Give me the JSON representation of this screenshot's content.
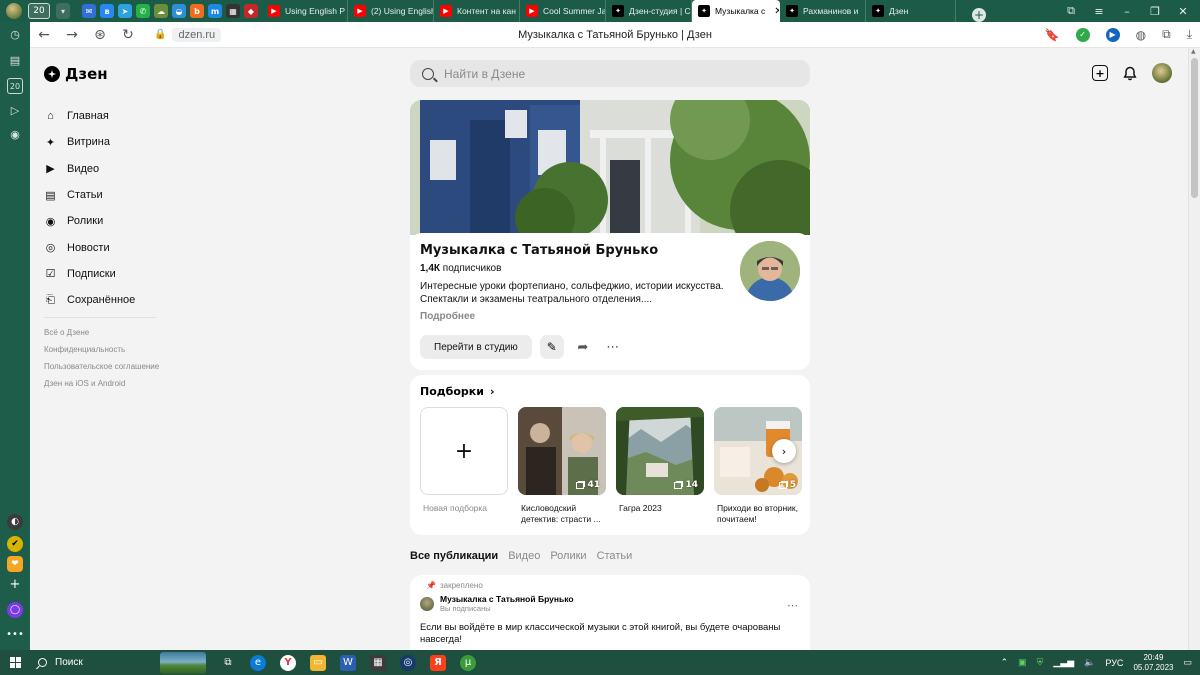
{
  "browser": {
    "tab_count": "20",
    "tabs": [
      {
        "label": "Using English P",
        "icon": "youtube-icon",
        "color": "#ff0000"
      },
      {
        "label": "(2) Using English",
        "icon": "youtube-icon",
        "color": "#ff0000"
      },
      {
        "label": "Контент на кан",
        "icon": "youtube-icon",
        "color": "#ff0000"
      },
      {
        "label": "Cool Summer Ja",
        "icon": "youtube-icon",
        "color": "#ff0000"
      },
      {
        "label": "Дзен-студия | С",
        "icon": "dzen-icon",
        "color": "#000000"
      },
      {
        "label": "Музыкалка с",
        "icon": "dzen-icon",
        "color": "#000000",
        "active": true
      },
      {
        "label": "Рахманинов и",
        "icon": "dzen-icon",
        "color": "#000000"
      },
      {
        "label": "Дзен",
        "icon": "dzen-icon",
        "color": "#000000"
      }
    ],
    "url_domain": "dzen.ru",
    "page_title": "Музыкалка с Татьяной Брунько | Дзен",
    "side_badge": "20"
  },
  "dzen": {
    "logo": "Дзен",
    "search_placeholder": "Найти в Дзене",
    "menu": [
      {
        "label": "Главная",
        "icon": "home-icon"
      },
      {
        "label": "Витрина",
        "icon": "sparkle-icon"
      },
      {
        "label": "Видео",
        "icon": "video-icon"
      },
      {
        "label": "Статьи",
        "icon": "article-icon"
      },
      {
        "label": "Ролики",
        "icon": "clips-icon"
      },
      {
        "label": "Новости",
        "icon": "news-icon"
      },
      {
        "label": "Подписки",
        "icon": "subscriptions-icon"
      },
      {
        "label": "Сохранённое",
        "icon": "bookmark-icon"
      }
    ],
    "footer_links": [
      "Всё о Дзене",
      "Конфиденциальность",
      "Пользовательское соглашение",
      "Дзен на iOS и Android"
    ]
  },
  "channel": {
    "name": "Музыкалка с Татьяной Брунько",
    "subs_count": "1,4К",
    "subs_label": "подписчиков",
    "description": "Интересные уроки фортепиано, сольфеджио, истории искусства. Спектакли и экзамены театрального отделения....",
    "more": "Подробнее",
    "studio_button": "Перейти в студию"
  },
  "collections": {
    "heading": "Подборки",
    "new_label": "Новая подборка",
    "items": [
      {
        "title": "Кисловодский детектив: страсти ...",
        "count": "41"
      },
      {
        "title": "Гагра 2023",
        "count": "14"
      },
      {
        "title": "Приходи во вторник, почитаем!",
        "count": "5"
      }
    ]
  },
  "publications": {
    "tabs": [
      "Все публикации",
      "Видео",
      "Ролики",
      "Статьи"
    ],
    "active_tab": 0
  },
  "post": {
    "pinned": "закреплено",
    "author": "Музыкалка с Татьяной Брунько",
    "author_sub": "Вы подписаны",
    "text": "Если вы войдёте в мир классической музыки с этой книгой, вы будете очарованы навсегда!"
  },
  "taskbar": {
    "search_label": "Поиск",
    "lang": "РУС",
    "time": "20:49",
    "date": "05.07.2023"
  },
  "colors": {
    "browser_frame": "#1c5b47",
    "taskbar": "#1f4f3f",
    "page_bg": "#f3f3f3"
  }
}
